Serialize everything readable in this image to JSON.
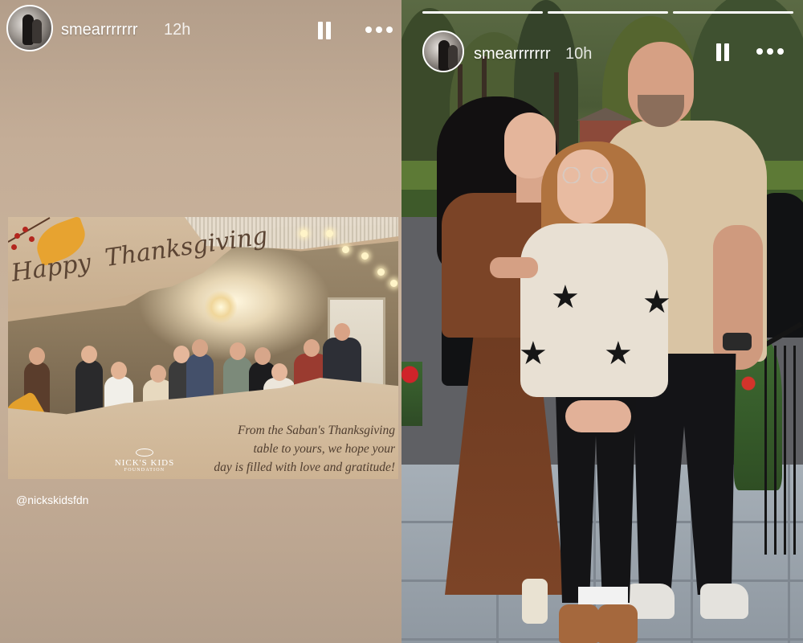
{
  "left_story": {
    "username": "smearrrrrrr",
    "time_ago": "12h",
    "card": {
      "title_line1": "Happy",
      "title_line2": "Thanksgiving",
      "message_line1": "From the Saban's Thanksgiving",
      "message_line2": "table to yours, we hope your",
      "message_line3": "day is filled with love and gratitude!",
      "logo_name": "NICK'S KIDS",
      "logo_sub": "FOUNDATION"
    },
    "mention": "@nickskidsfdn"
  },
  "right_story": {
    "username": "smearrrrrrr",
    "time_ago": "10h",
    "progress_segments": 3,
    "progress_done": 3
  },
  "icons": {
    "pause": "pause-icon",
    "more": "more-options-icon",
    "star": "★"
  },
  "colors": {
    "card_text": "#5b4433",
    "left_bg": "#c4ad97",
    "overlay_text": "#ffffff"
  }
}
